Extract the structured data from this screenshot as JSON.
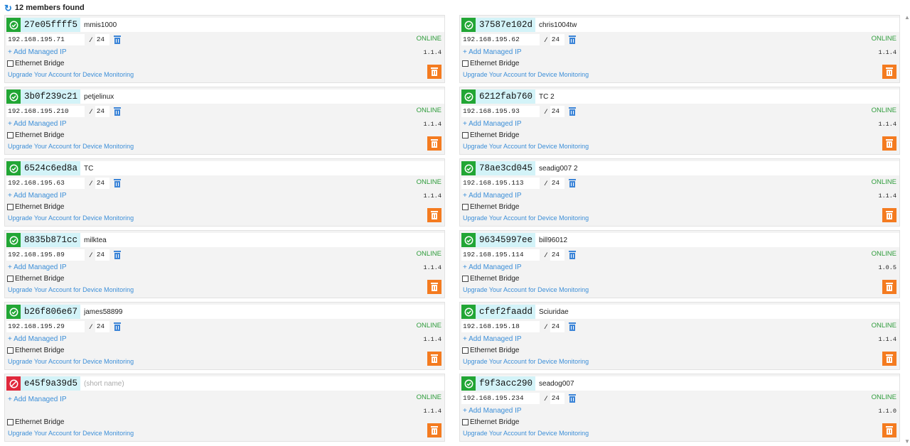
{
  "header": {
    "title": "12 members found"
  },
  "labels": {
    "add_ip": "+ Add Managed IP",
    "ethernet_bridge": "Ethernet Bridge",
    "upgrade": "Upgrade Your Account for Device Monitoring",
    "name_placeholder": "(short name)"
  },
  "colors": {
    "online_green": "#22a635",
    "offline_red": "#e0283c",
    "accent_blue": "#3d8fd8",
    "orange": "#f47b20",
    "id_bg": "#d3f3f8"
  },
  "members": [
    {
      "id": "27e05ffff5",
      "name": "mmis1000",
      "ip": "192.168.195.71",
      "mask": "24",
      "status": "ONLINE",
      "version": "1.1.4",
      "authorized": true
    },
    {
      "id": "37587e102d",
      "name": "chris1004tw",
      "ip": "192.168.195.62",
      "mask": "24",
      "status": "ONLINE",
      "version": "1.1.4",
      "authorized": true
    },
    {
      "id": "3b0f239c21",
      "name": "petjelinux",
      "ip": "192.168.195.210",
      "mask": "24",
      "status": "ONLINE",
      "version": "1.1.4",
      "authorized": true
    },
    {
      "id": "6212fab760",
      "name": "TC 2",
      "ip": "192.168.195.93",
      "mask": "24",
      "status": "ONLINE",
      "version": "1.1.4",
      "authorized": true
    },
    {
      "id": "6524c6ed8a",
      "name": "TC",
      "ip": "192.168.195.63",
      "mask": "24",
      "status": "ONLINE",
      "version": "1.1.4",
      "authorized": true
    },
    {
      "id": "78ae3cd045",
      "name": "seadig007 2",
      "ip": "192.168.195.113",
      "mask": "24",
      "status": "ONLINE",
      "version": "1.1.4",
      "authorized": true
    },
    {
      "id": "8835b871cc",
      "name": "milktea",
      "ip": "192.168.195.89",
      "mask": "24",
      "status": "ONLINE",
      "version": "1.1.4",
      "authorized": true
    },
    {
      "id": "96345997ee",
      "name": "bill96012",
      "ip": "192.168.195.114",
      "mask": "24",
      "status": "ONLINE",
      "version": "1.0.5",
      "authorized": true
    },
    {
      "id": "b26f806e67",
      "name": "james58899",
      "ip": "192.168.195.29",
      "mask": "24",
      "status": "ONLINE",
      "version": "1.1.4",
      "authorized": true
    },
    {
      "id": "cfef2faadd",
      "name": "Sciuridae",
      "ip": "192.168.195.18",
      "mask": "24",
      "status": "ONLINE",
      "version": "1.1.4",
      "authorized": true
    },
    {
      "id": "e45f9a39d5",
      "name": "",
      "ip": "",
      "mask": "",
      "status": "ONLINE",
      "version": "1.1.4",
      "authorized": false
    },
    {
      "id": "f9f3acc290",
      "name": "seadog007",
      "ip": "192.168.195.234",
      "mask": "24",
      "status": "ONLINE",
      "version": "1.1.0",
      "authorized": true
    }
  ]
}
